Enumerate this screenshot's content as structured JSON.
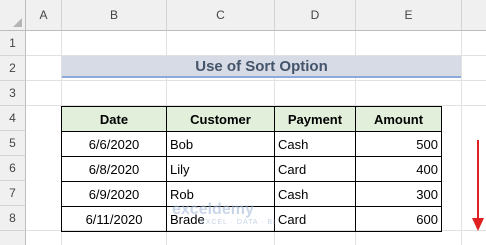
{
  "columns": [
    "A",
    "B",
    "C",
    "D",
    "E"
  ],
  "rows": [
    "1",
    "2",
    "3",
    "4",
    "5",
    "6",
    "7",
    "8"
  ],
  "title": "Use of Sort Option",
  "table": {
    "headers": [
      "Date",
      "Customer",
      "Payment",
      "Amount"
    ],
    "rows": [
      [
        "6/6/2020",
        "Bob",
        "Cash",
        "500"
      ],
      [
        "6/8/2020",
        "Lily",
        "Card",
        "400"
      ],
      [
        "6/9/2020",
        "Rob",
        "Cash",
        "300"
      ],
      [
        "6/11/2020",
        "Brade",
        "Card",
        "600"
      ]
    ]
  },
  "watermark": {
    "text": "exceldemy",
    "subtext": "EXCEL · DATA · BI"
  },
  "colors": {
    "header_fill": "#e2efda",
    "title_fill": "#d6dbe5",
    "title_text": "#44546a",
    "arrow": "#e02020"
  },
  "icons": {
    "sort_arrow": "arrow-down-icon",
    "watermark_logo": "exceldemy-logo-icon"
  }
}
